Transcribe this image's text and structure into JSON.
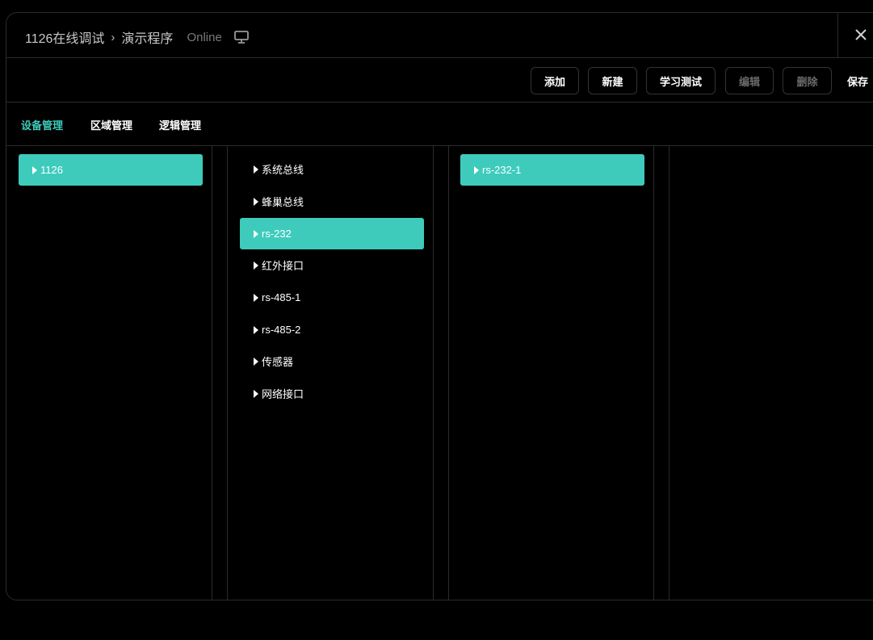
{
  "header": {
    "breadcrumb_root": "1126在线调试",
    "breadcrumb_current": "演示程序",
    "status": "Online",
    "status_icon": "monitor-icon",
    "close_icon": "close-icon"
  },
  "toolbar": {
    "add_label": "添加",
    "new_label": "新建",
    "learn_test_label": "学习测试",
    "edit_label": "编辑",
    "delete_label": "删除",
    "save_label": "保存"
  },
  "tabs": [
    {
      "label": "设备管理",
      "active": true
    },
    {
      "label": "区域管理",
      "active": false
    },
    {
      "label": "逻辑管理",
      "active": false
    }
  ],
  "devices": [
    {
      "label": "1126",
      "selected": true
    }
  ],
  "interfaces": [
    {
      "label": "系统总线",
      "selected": false
    },
    {
      "label": "蜂巢总线",
      "selected": false
    },
    {
      "label": "rs-232",
      "selected": true
    },
    {
      "label": "红外接口",
      "selected": false
    },
    {
      "label": "rs-485-1",
      "selected": false
    },
    {
      "label": "rs-485-2",
      "selected": false
    },
    {
      "label": "传感器",
      "selected": false
    },
    {
      "label": "网络接口",
      "selected": false
    }
  ],
  "ports": [
    {
      "label": "rs-232-1",
      "selected": true
    }
  ],
  "colors": {
    "accent": "#3ecbbc",
    "background": "#000000",
    "border": "#2b2b2b",
    "disabled_text": "#6b6b6b"
  }
}
